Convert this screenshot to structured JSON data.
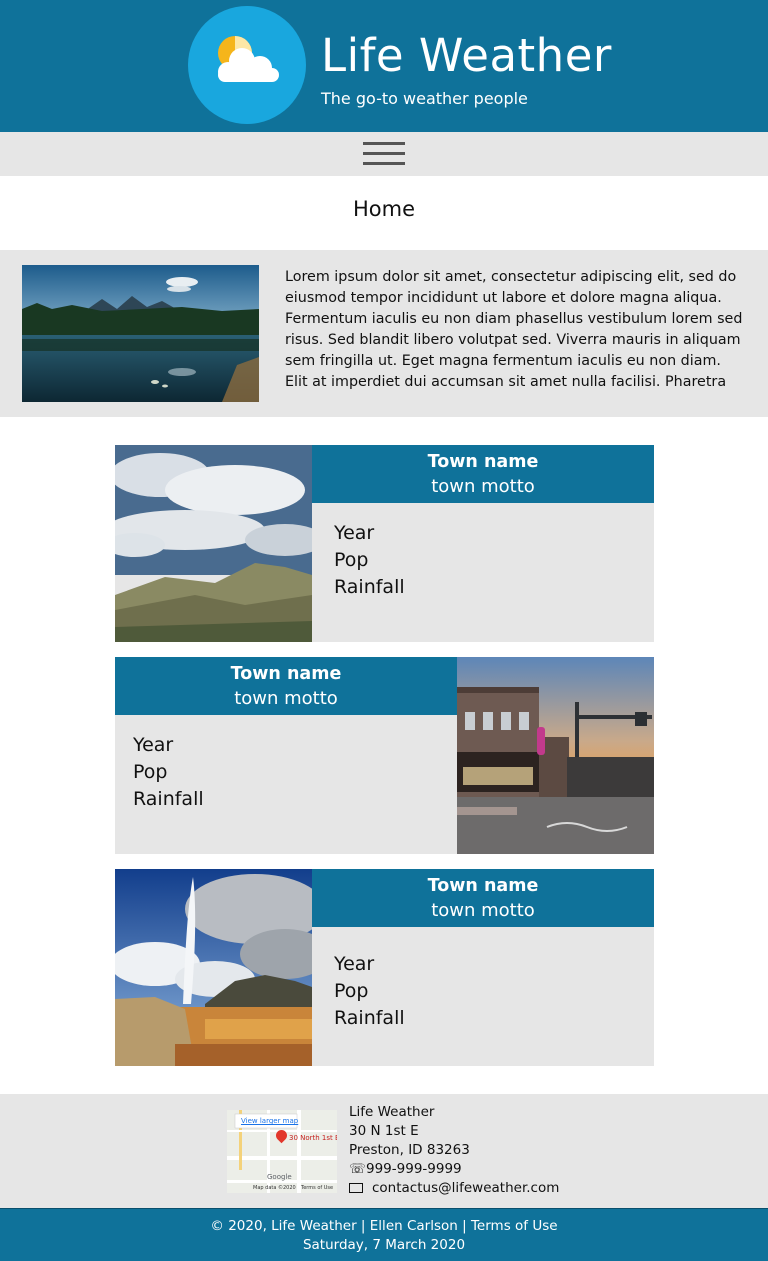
{
  "header": {
    "title": "Life Weather",
    "tagline": "The go-to weather people",
    "logo_icon": "sun-cloud-icon",
    "brand_color": "#0f729a",
    "logo_color": "#19a7de"
  },
  "nav": {
    "menu_icon": "hamburger-menu-icon"
  },
  "page": {
    "heading": "Home"
  },
  "intro": {
    "image": "lake-mountains-photo",
    "text": "Lorem ipsum dolor sit amet, consectetur adipiscing elit, sed do eiusmod tempor incididunt ut labore et dolore magna aliqua. Fermentum iaculis eu non diam phasellus vestibulum lorem sed risus. Sed blandit libero volutpat sed. Viverra mauris in aliquam sem fringilla ut. Eget magna fermentum iaculis eu non diam. Elit at imperdiet dui accumsan sit amet nulla facilisi. Pharetra"
  },
  "towns": [
    {
      "name": "Town name",
      "motto": "town motto",
      "year": "Year",
      "pop": "Pop",
      "rainfall": "Rainfall",
      "image": "hills-clouds-photo"
    },
    {
      "name": "Town name",
      "motto": "town motto",
      "year": "Year",
      "pop": "Pop",
      "rainfall": "Rainfall",
      "image": "street-dusk-photo"
    },
    {
      "name": "Town name",
      "motto": "town motto",
      "year": "Year",
      "pop": "Pop",
      "rainfall": "Rainfall",
      "image": "geyser-photo"
    }
  ],
  "footer": {
    "map": {
      "link": "View larger map",
      "pin_label": "30 North 1st E",
      "attribution": "Map data ©2020",
      "terms": "Terms of Use",
      "brand": "Google"
    },
    "contact": {
      "name": "Life Weather",
      "street": "30 N 1st E",
      "city": "Preston, ID 83263",
      "phone": "999-999-9999",
      "email": "contactus@lifeweather.com"
    },
    "copyright": "© 2020, Life Weather",
    "author": "Ellen Carlson",
    "terms": "Terms of Use",
    "separator": "|",
    "date": "Saturday, 7 March 2020"
  }
}
